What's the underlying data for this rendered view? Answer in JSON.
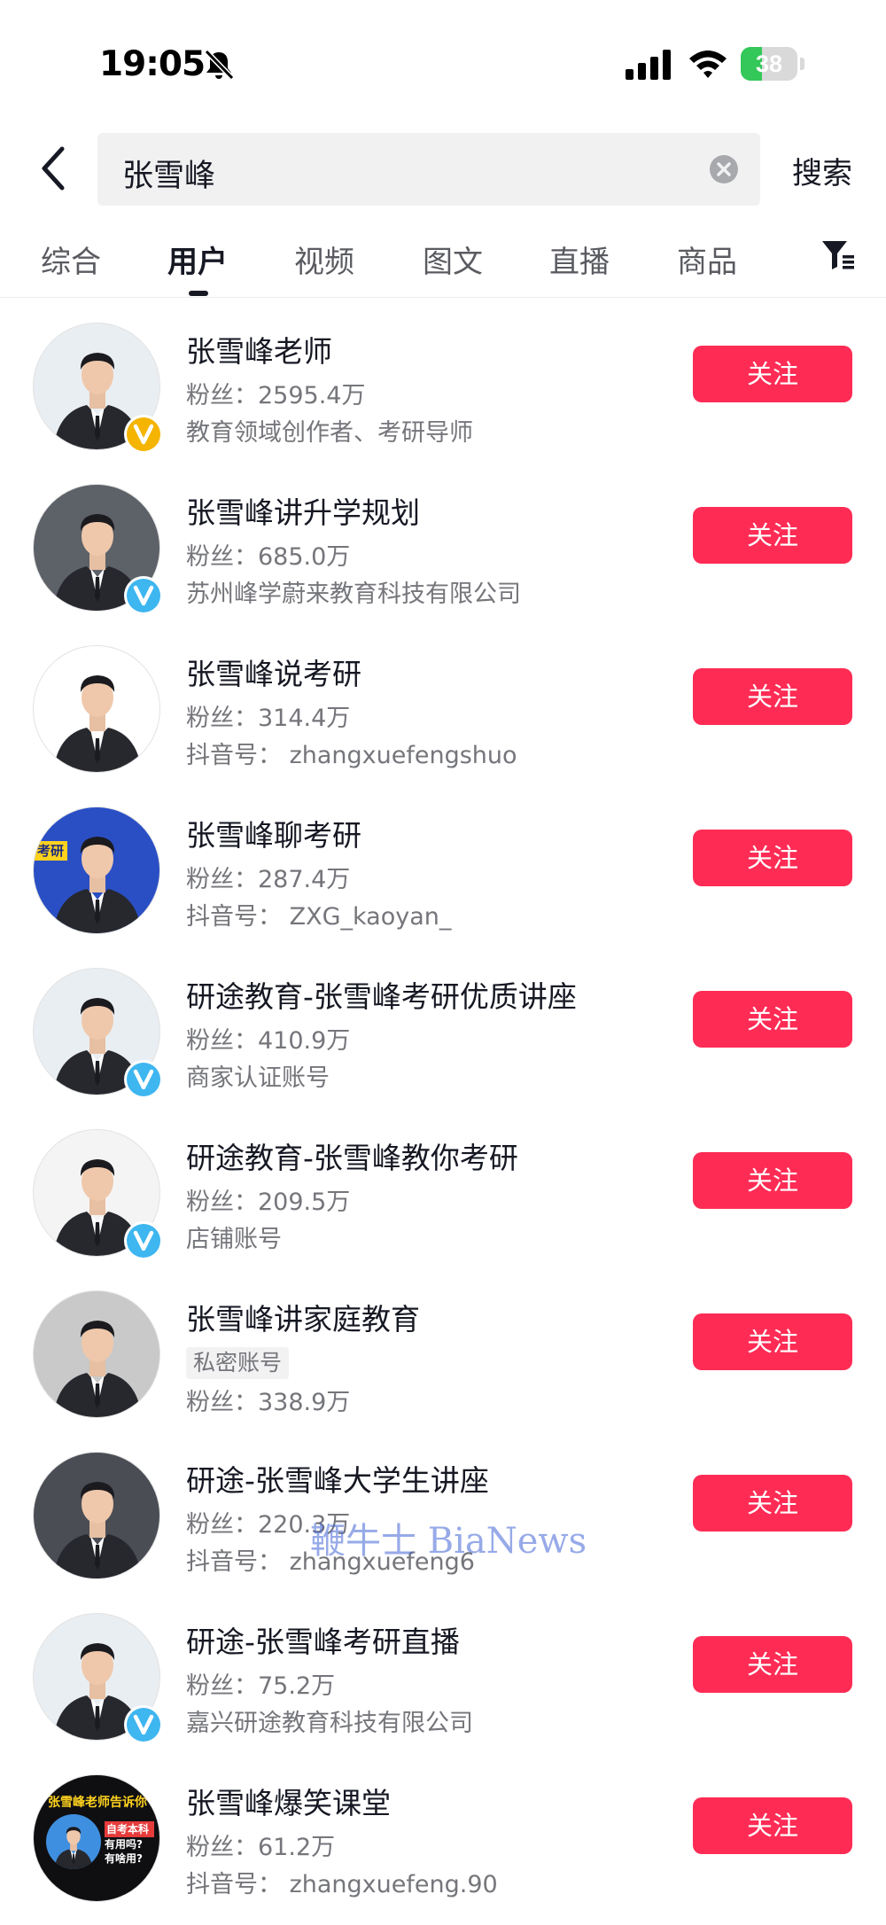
{
  "status_bar": {
    "time": "19:05",
    "battery": "38",
    "battery_level": 0.38
  },
  "search": {
    "query": "张雪峰",
    "submit_label": "搜索"
  },
  "tabs": [
    {
      "label": "综合",
      "active": false
    },
    {
      "label": "用户",
      "active": true
    },
    {
      "label": "视频",
      "active": false
    },
    {
      "label": "图文",
      "active": false
    },
    {
      "label": "直播",
      "active": false
    },
    {
      "label": "商品",
      "active": false
    }
  ],
  "users": [
    {
      "name": "张雪峰老师",
      "fans_label": "粉丝：",
      "fans": "2595.4万",
      "detail": "教育领域创作者、考研导师",
      "badge": "gold-v",
      "follow_label": "关注"
    },
    {
      "name": "张雪峰讲升学规划",
      "fans_label": "粉丝：",
      "fans": "685.0万",
      "detail": "苏州峰学蔚来教育科技有限公司",
      "badge": "blue-v",
      "follow_label": "关注"
    },
    {
      "name": "张雪峰说考研",
      "fans_label": "粉丝：",
      "fans": "314.4万",
      "detail": "抖音号：  zhangxuefengshuo",
      "badge": "",
      "follow_label": "关注"
    },
    {
      "name": "张雪峰聊考研",
      "fans_label": "粉丝：",
      "fans": "287.4万",
      "detail": "抖音号：  ZXG_kaoyan_",
      "badge": "",
      "follow_label": "关注"
    },
    {
      "name": "研途教育-张雪峰考研优质讲座",
      "fans_label": "粉丝：",
      "fans": "410.9万",
      "detail": "商家认证账号",
      "badge": "blue-v",
      "follow_label": "关注"
    },
    {
      "name": "研途教育-张雪峰教你考研",
      "fans_label": "粉丝：",
      "fans": "209.5万",
      "detail": "店铺账号",
      "badge": "blue-v",
      "follow_label": "关注"
    },
    {
      "name": "张雪峰讲家庭教育",
      "private_tag": "私密账号",
      "fans_label": "粉丝：",
      "fans": "338.9万",
      "badge": "",
      "follow_label": "关注"
    },
    {
      "name": "研途-张雪峰大学生讲座",
      "fans_label": "粉丝：",
      "fans": "220.3万",
      "detail": "抖音号：  zhangxuefeng6",
      "badge": "",
      "follow_label": "关注"
    },
    {
      "name": "研途-张雪峰考研直播",
      "fans_label": "粉丝：",
      "fans": "75.2万",
      "detail": "嘉兴研途教育科技有限公司",
      "badge": "blue-v",
      "follow_label": "关注"
    },
    {
      "name": "张雪峰爆笑课堂",
      "fans_label": "粉丝：",
      "fans": "61.2万",
      "detail": "抖音号：  zhangxuefeng.90",
      "badge": "",
      "follow_label": "关注"
    }
  ],
  "avatar_texts": {
    "kaoyan_tag": "考研",
    "banner_title": "张雪峰老师告诉你",
    "bubble_line1": "自考本科",
    "bubble_line2": "有用吗?",
    "bubble_line3": "有啥用?"
  },
  "watermark": "鞭牛士 BiaNews",
  "colors": {
    "accent": "#fe2c55",
    "text": "#161823",
    "secondary": "#75767b",
    "gold_badge": "#f4b400",
    "blue_badge": "#3eb6f0"
  }
}
